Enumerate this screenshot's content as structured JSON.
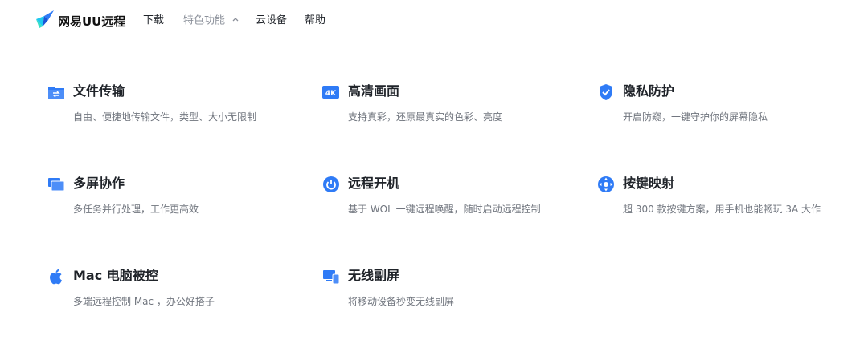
{
  "header": {
    "brand": "网易UU远程",
    "nav": [
      {
        "label": "下载"
      },
      {
        "label": "特色功能"
      },
      {
        "label": "云设备"
      },
      {
        "label": "帮助"
      }
    ]
  },
  "colors": {
    "accent": "#2f7bf6",
    "title": "#1f2329",
    "desc": "#70757e",
    "nav_active": "#8a8f99"
  },
  "features": [
    {
      "title": "文件传输",
      "desc": "自由、便捷地传输文件，类型、大小无限制",
      "icon": "folder-transfer-icon"
    },
    {
      "title": "高清画面",
      "desc": "支持真彩，还原最真实的色彩、亮度",
      "icon": "4k-icon",
      "icon_text": "4K"
    },
    {
      "title": "隐私防护",
      "desc": "开启防窥，一键守护你的屏幕隐私",
      "icon": "shield-check-icon"
    },
    {
      "title": "多屏协作",
      "desc": "多任务并行处理，工作更高效",
      "icon": "multi-screen-icon"
    },
    {
      "title": "远程开机",
      "desc": "基于 WOL 一键远程唤醒，随时启动远程控制",
      "icon": "power-icon"
    },
    {
      "title": "按键映射",
      "desc": "超 300 款按键方案，用手机也能畅玩 3A 大作",
      "icon": "gamepad-dpad-icon"
    },
    {
      "title": "Mac 电脑被控",
      "desc": "多端远程控制 Mac ，办公好搭子",
      "icon": "apple-icon"
    },
    {
      "title": "无线副屏",
      "desc": "将移动设备秒变无线副屏",
      "icon": "wireless-screen-icon"
    }
  ]
}
